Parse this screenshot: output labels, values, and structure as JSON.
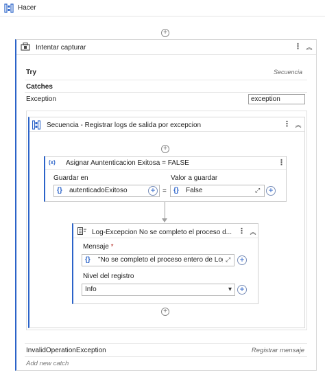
{
  "hacer": {
    "title": "Hacer"
  },
  "try_catch": {
    "title": "Intentar capturar",
    "try_label": "Try",
    "try_body": "Secuencia",
    "catches_label": "Catches",
    "exception_type": "Exception",
    "exception_var": "exception",
    "invalid_op": {
      "type": "InvalidOperationException",
      "action": "Registrar mensaje"
    },
    "add_catch": "Add new catch"
  },
  "sequence": {
    "title": "Secuencia - Registrar logs de salida por excepcion"
  },
  "assign": {
    "title": "Asignar Auntenticacion Exitosa = FALSE",
    "to_label": "Guardar en",
    "value_label": "Valor a guardar",
    "to_value": "autenticadoExitoso",
    "value_value": "False",
    "equals": "="
  },
  "log": {
    "title": "Log-Excepcion No se completo el proceso d...",
    "message_label": "Mensaje",
    "required_mark": "*",
    "message_value": "\"No se completo el proceso entero de Log",
    "level_label": "Nivel del registro",
    "level_value": "Info"
  },
  "icons": {
    "kebab": "⋮",
    "collapse": "︽",
    "plus": "+",
    "brace": "{}",
    "dropdown": "▾",
    "expand": "⤢"
  },
  "colors": {
    "accent": "#2b63c9",
    "border": "#d8d8d8"
  }
}
